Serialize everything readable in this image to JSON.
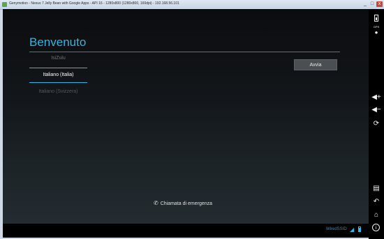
{
  "window": {
    "title": "Genymotion - Nexus 7 Jelly Bean with Google Apps - API 16 - 1280x800 (1280x800, 160dpi) - 192.168.56.101",
    "minimize": "_",
    "maximize": "□",
    "close": "x"
  },
  "welcome": {
    "heading": "Benvenuto",
    "languages": {
      "previous": "IsiZulu",
      "selected": "Italiano (Italia)",
      "next": "Italiano (Svizzera)"
    },
    "start_button": "Avvia",
    "emergency_call": "Chiamata di emergenza"
  },
  "status_bar": {
    "ssid": "WiredSSID",
    "wifi_icon": "wifi-icon",
    "battery_icon": "battery-icon"
  },
  "sidebar": {
    "gps_label": "GPS",
    "icons": [
      "battery-icon",
      "gps-icon",
      "volume-up-icon",
      "volume-down-icon",
      "rotate-icon",
      "recent-apps-icon",
      "back-icon",
      "home-icon",
      "info-icon"
    ]
  },
  "colors": {
    "accent": "#33b5e5",
    "screen_background": "#0b0c0e",
    "button_background": "#4a4f54"
  }
}
